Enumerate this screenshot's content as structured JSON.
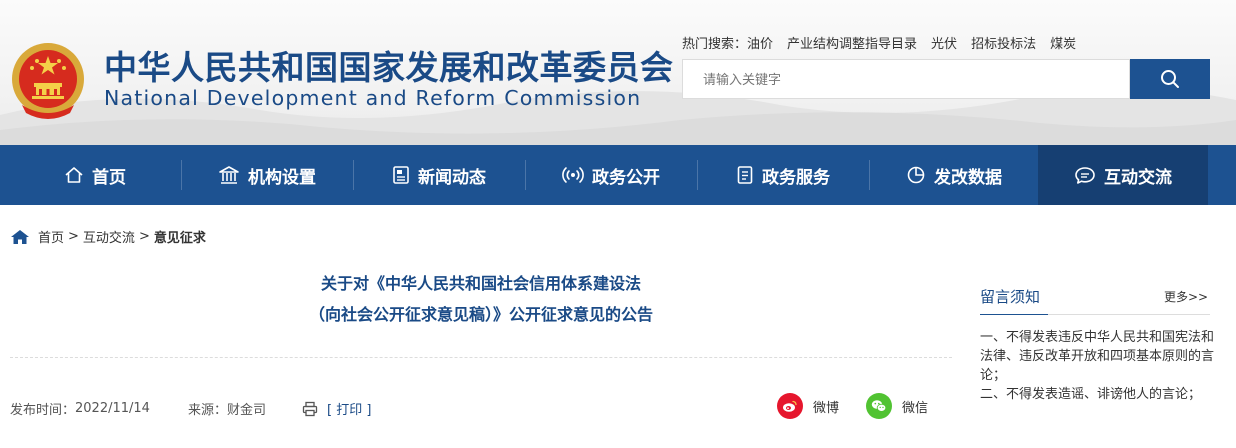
{
  "header": {
    "title_cn": "中华人民共和国国家发展和改革委员会",
    "title_en": "National Development and Reform Commission",
    "hot_label": "热门搜索：",
    "hot_items": [
      "油价",
      "产业结构调整指导目录",
      "光伏",
      "招标投标法",
      "煤炭"
    ],
    "search_placeholder": "请输入关键字"
  },
  "nav": {
    "items": [
      {
        "label": "首页",
        "icon": "home-icon"
      },
      {
        "label": "机构设置",
        "icon": "building-icon"
      },
      {
        "label": "新闻动态",
        "icon": "news-icon"
      },
      {
        "label": "政务公开",
        "icon": "broadcast-icon"
      },
      {
        "label": "政务服务",
        "icon": "document-icon"
      },
      {
        "label": "发改数据",
        "icon": "pie-chart-icon"
      },
      {
        "label": "互动交流",
        "icon": "chat-icon"
      }
    ],
    "active_index": 6
  },
  "breadcrumb": {
    "items": [
      "首页",
      "互动交流",
      "意见征求"
    ],
    "separator": ">"
  },
  "article": {
    "title_line1": "关于对《中华人民共和国社会信用体系建设法",
    "title_line2": "（向社会公开征求意见稿）》公开征求意见的公告",
    "publish_label": "发布时间：",
    "publish_date": "2022/11/14",
    "source_label": "来源：",
    "source": "财金司",
    "print_label": "[ 打印 ]",
    "share_weibo": "微博",
    "share_wechat": "微信"
  },
  "sidebar": {
    "title": "留言须知",
    "more": "更多>>",
    "rule1": "一、不得发表违反中华人民共和国宪法和法律、违反改革开放和四项基本原则的言论；",
    "rule2": "二、不得发表造谣、诽谤他人的言论；"
  },
  "colors": {
    "primary": "#1d5291",
    "title": "#1a4a86",
    "weibo": "#e6162d",
    "wechat": "#51c332"
  }
}
